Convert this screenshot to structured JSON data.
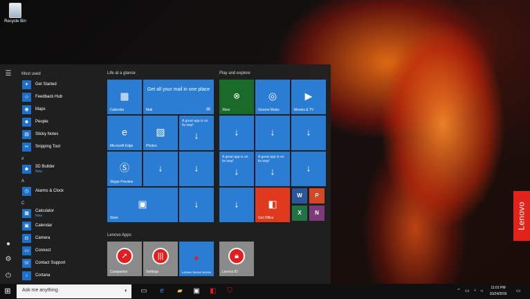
{
  "desktop": {
    "recycle_bin_label": "Recycle Bin",
    "brand_badge": "Lenovo"
  },
  "start": {
    "most_used_header": "Most used",
    "most_used": [
      {
        "name": "Get Started",
        "icon": "lightbulb-icon"
      },
      {
        "name": "Feedback Hub",
        "icon": "feedback-icon"
      },
      {
        "name": "Maps",
        "icon": "map-icon"
      },
      {
        "name": "People",
        "icon": "people-icon"
      },
      {
        "name": "Sticky Notes",
        "icon": "note-icon"
      },
      {
        "name": "Snipping Tool",
        "icon": "scissors-icon"
      }
    ],
    "letter_hash": "#",
    "app_3d": "3D Builder",
    "app_3d_sub": "New",
    "letter_a": "A",
    "app_alarms": "Alarms & Clock",
    "letter_c": "C",
    "app_calculator": "Calculator",
    "app_calculator_sub": "New",
    "app_calendar": "Calendar",
    "app_camera": "Camera",
    "app_connect": "Connect",
    "app_contact": "Contact Support",
    "app_cortana": "Cortana",
    "group_life": "Life at a glance",
    "group_play": "Play and explore",
    "group_lenovo": "Lenovo Apps",
    "tiles": {
      "calendar": "Calendar",
      "mail_big": "Get all your mail in one place",
      "mail": "Mail",
      "edge": "Microsoft Edge",
      "photos": "Photos",
      "great_app": "A great app is on its way!",
      "skype": "Skype Preview",
      "store": "Store",
      "xbox": "Xbox",
      "groove": "Groove Music",
      "movies": "Movies & TV",
      "office": "Get Office",
      "companion": "Companion",
      "settings": "Settings",
      "lenovo_game": "Lenovo Nerve Sense",
      "lenovo_id": "Lenovo ID"
    }
  },
  "taskbar": {
    "search_placeholder": "Ask me anything",
    "time": "11:01 PM",
    "date": "10/24/2016"
  },
  "colors": {
    "tile_blue": "#2b7cd3",
    "tile_red": "#e03a1e",
    "tile_grey": "#8a8a8a",
    "lenovo_red": "#e2231a"
  }
}
